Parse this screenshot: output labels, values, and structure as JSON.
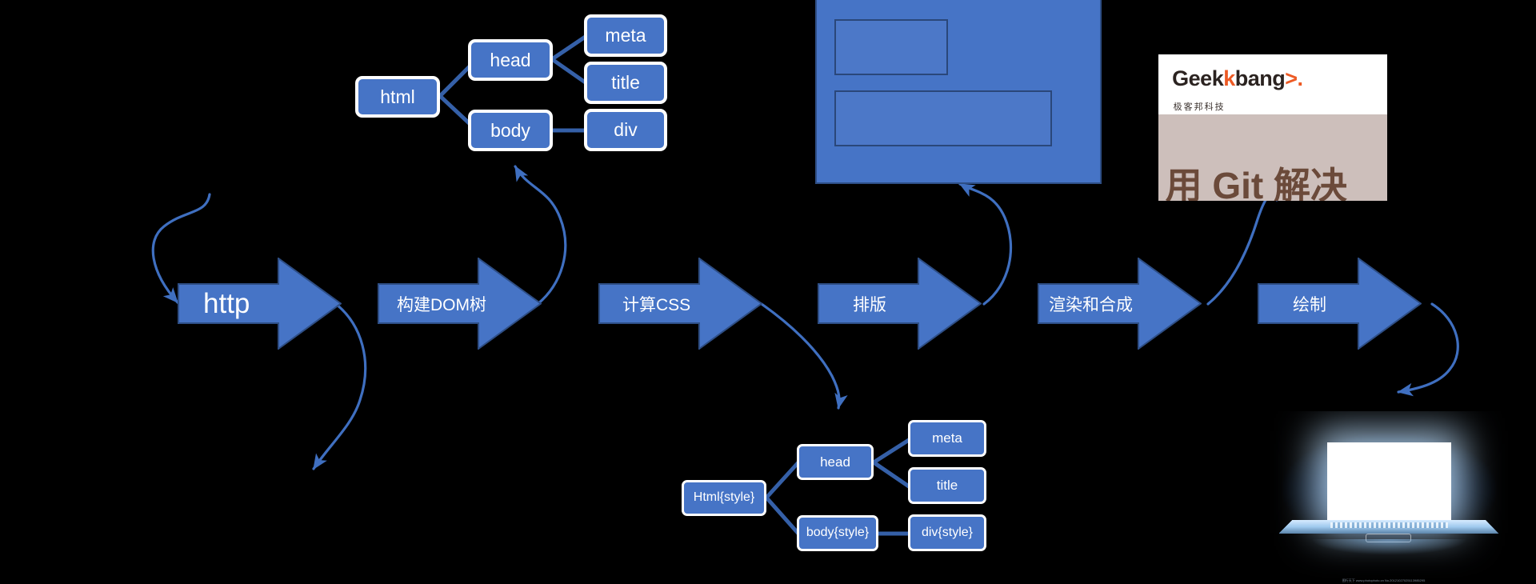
{
  "diagram": {
    "title": "browser-rendering-pipeline",
    "background_color": "#000000",
    "accent_color": "#4674C6",
    "node_border_color": "#FFFFFF",
    "connector_color": "#3F6FC0"
  },
  "pipeline": {
    "steps": [
      {
        "id": "http",
        "label": "http"
      },
      {
        "id": "dom",
        "label": "构建DOM树"
      },
      {
        "id": "css",
        "label": "计算CSS"
      },
      {
        "id": "layout",
        "label": "排版"
      },
      {
        "id": "composite",
        "label": "渲染和合成"
      },
      {
        "id": "paint",
        "label": "绘制"
      }
    ]
  },
  "dom_tree": {
    "caption": "dom-tree",
    "nodes": [
      {
        "id": "html",
        "label": "html"
      },
      {
        "id": "head",
        "label": "head"
      },
      {
        "id": "body",
        "label": "body"
      },
      {
        "id": "meta",
        "label": "meta"
      },
      {
        "id": "title",
        "label": "title"
      },
      {
        "id": "div",
        "label": "div"
      }
    ]
  },
  "cssom_tree": {
    "caption": "cssom-tree",
    "nodes": [
      {
        "id": "htmlstyle",
        "label": "Html{style}"
      },
      {
        "id": "head",
        "label": "head"
      },
      {
        "id": "bodystyle",
        "label": "body{style}"
      },
      {
        "id": "meta",
        "label": "meta"
      },
      {
        "id": "title",
        "label": "title"
      },
      {
        "id": "divstyle",
        "label": "div{style}"
      }
    ]
  },
  "layout_preview": {
    "caption": "layout-wireframe",
    "fill_color": "#4674C6",
    "box_count": 2
  },
  "render_preview": {
    "caption": "geekbang-page-screenshot",
    "brand": "Geek",
    "brand_k": "k",
    "brand_bang": "bang",
    "brand_arrow": ">",
    "brand_dot": ".",
    "brand_sub": "极客邦科技",
    "headline": "用 Git 解决"
  },
  "paint_preview": {
    "caption": "glowing-laptop-photo",
    "watermark": "图行天下 www.photophoto.cn  No.20121027025113985295"
  }
}
